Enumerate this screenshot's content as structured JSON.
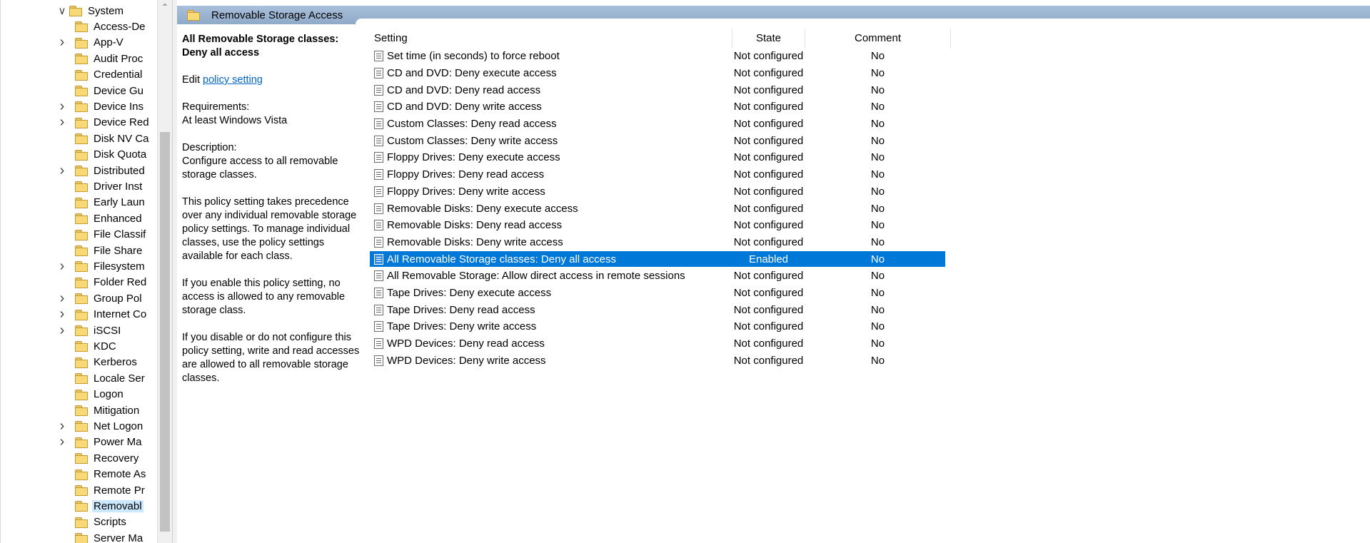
{
  "tree": {
    "items": [
      {
        "label": "System",
        "expander": "expanded",
        "level": 0
      },
      {
        "label": "Access-De",
        "expander": "none",
        "level": 1
      },
      {
        "label": "App-V",
        "expander": "collapsed",
        "level": 1
      },
      {
        "label": "Audit Proc",
        "expander": "none",
        "level": 1
      },
      {
        "label": "Credential",
        "expander": "none",
        "level": 1
      },
      {
        "label": "Device Gu",
        "expander": "none",
        "level": 1
      },
      {
        "label": "Device Ins",
        "expander": "collapsed",
        "level": 1
      },
      {
        "label": "Device Red",
        "expander": "collapsed",
        "level": 1
      },
      {
        "label": "Disk NV Ca",
        "expander": "none",
        "level": 1
      },
      {
        "label": "Disk Quota",
        "expander": "none",
        "level": 1
      },
      {
        "label": "Distributed",
        "expander": "collapsed",
        "level": 1
      },
      {
        "label": "Driver Inst",
        "expander": "none",
        "level": 1
      },
      {
        "label": "Early Laun",
        "expander": "none",
        "level": 1
      },
      {
        "label": "Enhanced",
        "expander": "none",
        "level": 1
      },
      {
        "label": "File Classif",
        "expander": "none",
        "level": 1
      },
      {
        "label": "File Share",
        "expander": "none",
        "level": 1
      },
      {
        "label": "Filesystem",
        "expander": "collapsed",
        "level": 1
      },
      {
        "label": "Folder Red",
        "expander": "none",
        "level": 1
      },
      {
        "label": "Group Pol",
        "expander": "collapsed",
        "level": 1
      },
      {
        "label": "Internet Co",
        "expander": "collapsed",
        "level": 1
      },
      {
        "label": "iSCSI",
        "expander": "collapsed",
        "level": 1
      },
      {
        "label": "KDC",
        "expander": "none",
        "level": 1
      },
      {
        "label": "Kerberos",
        "expander": "none",
        "level": 1
      },
      {
        "label": "Locale Ser",
        "expander": "none",
        "level": 1
      },
      {
        "label": "Logon",
        "expander": "none",
        "level": 1
      },
      {
        "label": "Mitigation",
        "expander": "none",
        "level": 1
      },
      {
        "label": "Net Logon",
        "expander": "collapsed",
        "level": 1
      },
      {
        "label": "Power Ma",
        "expander": "collapsed",
        "level": 1
      },
      {
        "label": "Recovery",
        "expander": "none",
        "level": 1
      },
      {
        "label": "Remote As",
        "expander": "none",
        "level": 1
      },
      {
        "label": "Remote Pr",
        "expander": "none",
        "level": 1
      },
      {
        "label": "Removabl",
        "expander": "none",
        "level": 1,
        "selected": true
      },
      {
        "label": "Scripts",
        "expander": "none",
        "level": 1
      },
      {
        "label": "Server Ma",
        "expander": "none",
        "level": 1
      }
    ]
  },
  "header": {
    "title": "Removable Storage Access"
  },
  "description": {
    "title": "All Removable Storage classes: Deny all access",
    "edit_prefix": "Edit",
    "edit_link": "policy setting",
    "requirements_label": "Requirements:",
    "requirements": "At least Windows Vista",
    "description_label": "Description:",
    "para1": "Configure access to all removable storage classes.",
    "para2": "This policy setting takes precedence over any individual removable storage policy settings. To manage individual classes, use the policy settings available for each class.",
    "para3": "If you enable this policy setting, no access is allowed to any removable storage class.",
    "para4": "If you disable or do not configure this policy setting, write and read accesses are allowed to all removable storage classes."
  },
  "table": {
    "columns": [
      "Setting",
      "State",
      "Comment"
    ],
    "rows": [
      {
        "setting": "Set time (in seconds) to force reboot",
        "state": "Not configured",
        "comment": "No"
      },
      {
        "setting": "CD and DVD: Deny execute access",
        "state": "Not configured",
        "comment": "No"
      },
      {
        "setting": "CD and DVD: Deny read access",
        "state": "Not configured",
        "comment": "No"
      },
      {
        "setting": "CD and DVD: Deny write access",
        "state": "Not configured",
        "comment": "No"
      },
      {
        "setting": "Custom Classes: Deny read access",
        "state": "Not configured",
        "comment": "No"
      },
      {
        "setting": "Custom Classes: Deny write access",
        "state": "Not configured",
        "comment": "No"
      },
      {
        "setting": "Floppy Drives: Deny execute access",
        "state": "Not configured",
        "comment": "No"
      },
      {
        "setting": "Floppy Drives: Deny read access",
        "state": "Not configured",
        "comment": "No"
      },
      {
        "setting": "Floppy Drives: Deny write access",
        "state": "Not configured",
        "comment": "No"
      },
      {
        "setting": "Removable Disks: Deny execute access",
        "state": "Not configured",
        "comment": "No"
      },
      {
        "setting": "Removable Disks: Deny read access",
        "state": "Not configured",
        "comment": "No"
      },
      {
        "setting": "Removable Disks: Deny write access",
        "state": "Not configured",
        "comment": "No"
      },
      {
        "setting": "All Removable Storage classes: Deny all access",
        "state": "Enabled",
        "comment": "No",
        "selected": true
      },
      {
        "setting": "All Removable Storage: Allow direct access in remote sessions",
        "state": "Not configured",
        "comment": "No"
      },
      {
        "setting": "Tape Drives: Deny execute access",
        "state": "Not configured",
        "comment": "No"
      },
      {
        "setting": "Tape Drives: Deny read access",
        "state": "Not configured",
        "comment": "No"
      },
      {
        "setting": "Tape Drives: Deny write access",
        "state": "Not configured",
        "comment": "No"
      },
      {
        "setting": "WPD Devices: Deny read access",
        "state": "Not configured",
        "comment": "No"
      },
      {
        "setting": "WPD Devices: Deny write access",
        "state": "Not configured",
        "comment": "No"
      }
    ]
  },
  "colors": {
    "selection": "#0078d7",
    "header_band": "#a9c0db",
    "link": "#0066cc",
    "folder": "#f7d978"
  }
}
